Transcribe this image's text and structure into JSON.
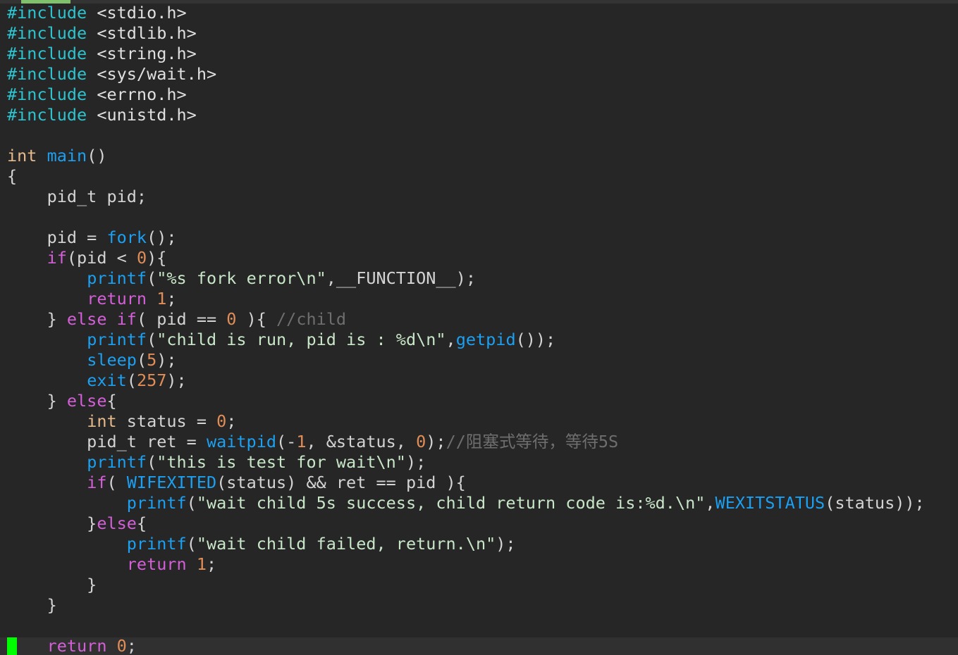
{
  "editor": {
    "colors": {
      "background": "#262626",
      "cursor_line": "#303030",
      "cursor": "#00ff00",
      "preproc": "#2ec4cf",
      "include_path": "#e0e0e0",
      "type": "#e6b98a",
      "function": "#1ba0f2",
      "keyword": "#d45fd8",
      "number": "#e08d57",
      "string": "#c8e6c8",
      "comment": "#6e6e6e",
      "text": "#d4d4d4"
    },
    "lines": [
      [
        {
          "t": "#include",
          "c": "preproc"
        },
        {
          "t": " <stdio.h>",
          "c": "include_path"
        }
      ],
      [
        {
          "t": "#include",
          "c": "preproc"
        },
        {
          "t": " <stdlib.h>",
          "c": "include_path"
        }
      ],
      [
        {
          "t": "#include",
          "c": "preproc"
        },
        {
          "t": " <string.h>",
          "c": "include_path"
        }
      ],
      [
        {
          "t": "#include",
          "c": "preproc"
        },
        {
          "t": " <sys/wait.h>",
          "c": "include_path"
        }
      ],
      [
        {
          "t": "#include",
          "c": "preproc"
        },
        {
          "t": " <errno.h>",
          "c": "include_path"
        }
      ],
      [
        {
          "t": "#include",
          "c": "preproc"
        },
        {
          "t": " <unistd.h>",
          "c": "include_path"
        }
      ],
      [],
      [
        {
          "t": "int",
          "c": "type"
        },
        {
          "t": " ",
          "c": "text"
        },
        {
          "t": "main",
          "c": "function"
        },
        {
          "t": "()",
          "c": "text"
        }
      ],
      [
        {
          "t": "{",
          "c": "text"
        }
      ],
      [
        {
          "t": "    pid_t pid;",
          "c": "text"
        }
      ],
      [],
      [
        {
          "t": "    pid = ",
          "c": "text"
        },
        {
          "t": "fork",
          "c": "function"
        },
        {
          "t": "();",
          "c": "text"
        }
      ],
      [
        {
          "t": "    ",
          "c": "text"
        },
        {
          "t": "if",
          "c": "keyword"
        },
        {
          "t": "(pid < ",
          "c": "text"
        },
        {
          "t": "0",
          "c": "number"
        },
        {
          "t": "){",
          "c": "text"
        }
      ],
      [
        {
          "t": "        ",
          "c": "text"
        },
        {
          "t": "printf",
          "c": "function"
        },
        {
          "t": "(",
          "c": "text"
        },
        {
          "t": "\"%s fork error\\n\"",
          "c": "string"
        },
        {
          "t": ",__FUNCTION__);",
          "c": "text"
        }
      ],
      [
        {
          "t": "        ",
          "c": "text"
        },
        {
          "t": "return",
          "c": "keyword"
        },
        {
          "t": " ",
          "c": "text"
        },
        {
          "t": "1",
          "c": "number"
        },
        {
          "t": ";",
          "c": "text"
        }
      ],
      [
        {
          "t": "    } ",
          "c": "text"
        },
        {
          "t": "else",
          "c": "keyword"
        },
        {
          "t": " ",
          "c": "text"
        },
        {
          "t": "if",
          "c": "keyword"
        },
        {
          "t": "( pid == ",
          "c": "text"
        },
        {
          "t": "0",
          "c": "number"
        },
        {
          "t": " ){ ",
          "c": "text"
        },
        {
          "t": "//child",
          "c": "comment"
        }
      ],
      [
        {
          "t": "        ",
          "c": "text"
        },
        {
          "t": "printf",
          "c": "function"
        },
        {
          "t": "(",
          "c": "text"
        },
        {
          "t": "\"child is run, pid is : %d\\n\"",
          "c": "string"
        },
        {
          "t": ",",
          "c": "text"
        },
        {
          "t": "getpid",
          "c": "function"
        },
        {
          "t": "());",
          "c": "text"
        }
      ],
      [
        {
          "t": "        ",
          "c": "text"
        },
        {
          "t": "sleep",
          "c": "function"
        },
        {
          "t": "(",
          "c": "text"
        },
        {
          "t": "5",
          "c": "number"
        },
        {
          "t": ");",
          "c": "text"
        }
      ],
      [
        {
          "t": "        ",
          "c": "text"
        },
        {
          "t": "exit",
          "c": "function"
        },
        {
          "t": "(",
          "c": "text"
        },
        {
          "t": "257",
          "c": "number"
        },
        {
          "t": ");",
          "c": "text"
        }
      ],
      [
        {
          "t": "    } ",
          "c": "text"
        },
        {
          "t": "else",
          "c": "keyword"
        },
        {
          "t": "{",
          "c": "text"
        }
      ],
      [
        {
          "t": "        ",
          "c": "text"
        },
        {
          "t": "int",
          "c": "type"
        },
        {
          "t": " status = ",
          "c": "text"
        },
        {
          "t": "0",
          "c": "number"
        },
        {
          "t": ";",
          "c": "text"
        }
      ],
      [
        {
          "t": "        pid_t ret = ",
          "c": "text"
        },
        {
          "t": "waitpid",
          "c": "function"
        },
        {
          "t": "(-",
          "c": "text"
        },
        {
          "t": "1",
          "c": "number"
        },
        {
          "t": ", &status, ",
          "c": "text"
        },
        {
          "t": "0",
          "c": "number"
        },
        {
          "t": ");",
          "c": "text"
        },
        {
          "t": "//阻塞式等待，等待5S",
          "c": "comment"
        }
      ],
      [
        {
          "t": "        ",
          "c": "text"
        },
        {
          "t": "printf",
          "c": "function"
        },
        {
          "t": "(",
          "c": "text"
        },
        {
          "t": "\"this is test for wait\\n\"",
          "c": "string"
        },
        {
          "t": ");",
          "c": "text"
        }
      ],
      [
        {
          "t": "        ",
          "c": "text"
        },
        {
          "t": "if",
          "c": "keyword"
        },
        {
          "t": "( ",
          "c": "text"
        },
        {
          "t": "WIFEXITED",
          "c": "function"
        },
        {
          "t": "(status) && ret == pid ){",
          "c": "text"
        }
      ],
      [
        {
          "t": "            ",
          "c": "text"
        },
        {
          "t": "printf",
          "c": "function"
        },
        {
          "t": "(",
          "c": "text"
        },
        {
          "t": "\"wait child 5s success, child return code is:%d.\\n\"",
          "c": "string"
        },
        {
          "t": ",",
          "c": "text"
        },
        {
          "t": "WEXITSTATUS",
          "c": "function"
        },
        {
          "t": "(status));",
          "c": "text"
        }
      ],
      [
        {
          "t": "        }",
          "c": "text"
        },
        {
          "t": "else",
          "c": "keyword"
        },
        {
          "t": "{",
          "c": "text"
        }
      ],
      [
        {
          "t": "            ",
          "c": "text"
        },
        {
          "t": "printf",
          "c": "function"
        },
        {
          "t": "(",
          "c": "text"
        },
        {
          "t": "\"wait child failed, return.\\n\"",
          "c": "string"
        },
        {
          "t": ");",
          "c": "text"
        }
      ],
      [
        {
          "t": "            ",
          "c": "text"
        },
        {
          "t": "return",
          "c": "keyword"
        },
        {
          "t": " ",
          "c": "text"
        },
        {
          "t": "1",
          "c": "number"
        },
        {
          "t": ";",
          "c": "text"
        }
      ],
      [
        {
          "t": "        }",
          "c": "text"
        }
      ],
      [
        {
          "t": "    }",
          "c": "text"
        }
      ],
      [],
      [
        {
          "t": "    ",
          "c": "text"
        },
        {
          "t": "return",
          "c": "keyword"
        },
        {
          "t": " ",
          "c": "text"
        },
        {
          "t": "0",
          "c": "number"
        },
        {
          "t": ";",
          "c": "text"
        }
      ]
    ]
  }
}
